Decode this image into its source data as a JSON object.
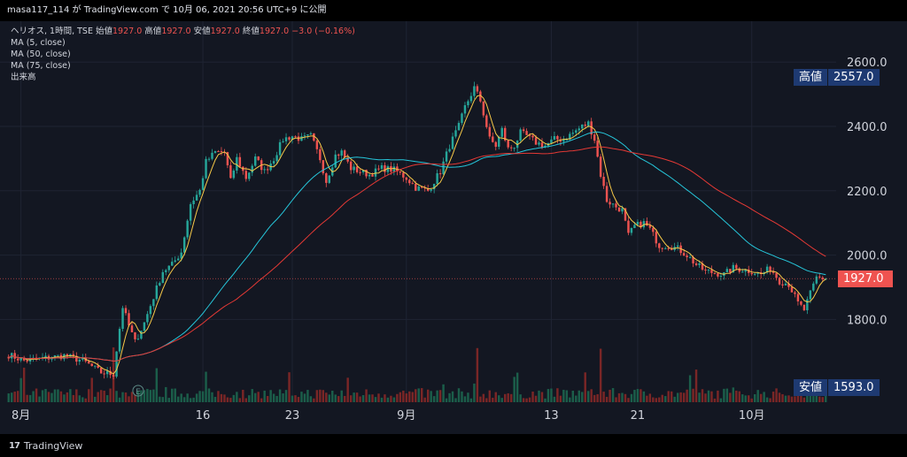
{
  "header": {
    "text": "masa117_114 が TradingView.com で 10月 06, 2021 20:56 UTC+9 に公開"
  },
  "legend": {
    "symbol": "ヘリオス, 1時間, TSE",
    "open_label": "始値",
    "open": "1927.0",
    "high_label": "高値",
    "high": "1927.0",
    "low_label": "安値",
    "low": "1927.0",
    "close_label": "終値",
    "close": "1927.0",
    "change": "−3.0 (−0.16%)",
    "ma1": "MA (5, close)",
    "ma2": "MA (50, close)",
    "ma3": "MA (75, close)",
    "volume": "出来高"
  },
  "markers": {
    "high_label": "高値",
    "high_value": "2557.0",
    "low_label": "安値",
    "low_value": "1593.0",
    "last_price": "1927.0"
  },
  "earnings_marker": "E",
  "footer": {
    "brand": "TradingView"
  },
  "colors": {
    "background": "#131722",
    "up": "#26a69a",
    "down": "#ef5350",
    "ma5": "#f7c948",
    "ma50": "#26c6da",
    "ma75": "#e53935",
    "marker_bg": "#1e3a72"
  },
  "chart_data": {
    "type": "candlestick",
    "title": "ヘリオス, 1時間, TSE",
    "ylim": [
      1600,
      2700
    ],
    "yticks": [
      1800,
      2000,
      2200,
      2400,
      2600
    ],
    "ytick_labels": [
      "1800.0",
      "2000.0",
      "2200.0",
      "2400.0",
      "2600.0"
    ],
    "xticks": [
      {
        "label": "8月",
        "bar": 4
      },
      {
        "label": "16",
        "bar": 63
      },
      {
        "label": "23",
        "bar": 92
      },
      {
        "label": "9月",
        "bar": 129
      },
      {
        "label": "13",
        "bar": 176
      },
      {
        "label": "21",
        "bar": 204
      },
      {
        "label": "10月",
        "bar": 241
      }
    ],
    "bar_count": 266,
    "price_path": [
      [
        0,
        1690
      ],
      [
        5,
        1672
      ],
      [
        12,
        1680
      ],
      [
        18,
        1688
      ],
      [
        24,
        1672
      ],
      [
        30,
        1635
      ],
      [
        34,
        1630
      ],
      [
        35,
        1705
      ],
      [
        37,
        1840
      ],
      [
        39,
        1780
      ],
      [
        41,
        1730
      ],
      [
        44,
        1790
      ],
      [
        47,
        1870
      ],
      [
        50,
        1950
      ],
      [
        53,
        1970
      ],
      [
        56,
        2010
      ],
      [
        59,
        2160
      ],
      [
        62,
        2200
      ],
      [
        64,
        2290
      ],
      [
        67,
        2320
      ],
      [
        70,
        2320
      ],
      [
        72,
        2230
      ],
      [
        74,
        2300
      ],
      [
        77,
        2240
      ],
      [
        80,
        2300
      ],
      [
        83,
        2260
      ],
      [
        86,
        2300
      ],
      [
        89,
        2360
      ],
      [
        92,
        2370
      ],
      [
        95,
        2360
      ],
      [
        98,
        2370
      ],
      [
        101,
        2300
      ],
      [
        103,
        2230
      ],
      [
        106,
        2310
      ],
      [
        108,
        2320
      ],
      [
        111,
        2270
      ],
      [
        114,
        2260
      ],
      [
        117,
        2250
      ],
      [
        121,
        2270
      ],
      [
        125,
        2265
      ],
      [
        129,
        2240
      ],
      [
        132,
        2210
      ],
      [
        136,
        2200
      ],
      [
        140,
        2260
      ],
      [
        143,
        2340
      ],
      [
        146,
        2400
      ],
      [
        148,
        2460
      ],
      [
        151,
        2520
      ],
      [
        153,
        2480
      ],
      [
        156,
        2360
      ],
      [
        158,
        2340
      ],
      [
        160,
        2390
      ],
      [
        162,
        2330
      ],
      [
        164,
        2340
      ],
      [
        166,
        2380
      ],
      [
        168,
        2370
      ],
      [
        171,
        2350
      ],
      [
        174,
        2340
      ],
      [
        177,
        2360
      ],
      [
        180,
        2360
      ],
      [
        183,
        2380
      ],
      [
        186,
        2400
      ],
      [
        188,
        2410
      ],
      [
        190,
        2360
      ],
      [
        192,
        2250
      ],
      [
        194,
        2170
      ],
      [
        197,
        2150
      ],
      [
        199,
        2140
      ],
      [
        201,
        2060
      ],
      [
        203,
        2090
      ],
      [
        206,
        2100
      ],
      [
        208,
        2080
      ],
      [
        211,
        2030
      ],
      [
        214,
        2030
      ],
      [
        217,
        2020
      ],
      [
        220,
        2000
      ],
      [
        223,
        1970
      ],
      [
        226,
        1950
      ],
      [
        229,
        1945
      ],
      [
        232,
        1940
      ],
      [
        235,
        1960
      ],
      [
        238,
        1955
      ],
      [
        241,
        1950
      ],
      [
        244,
        1940
      ],
      [
        247,
        1960
      ],
      [
        250,
        1920
      ],
      [
        253,
        1910
      ],
      [
        256,
        1850
      ],
      [
        258,
        1830
      ],
      [
        260,
        1880
      ],
      [
        262,
        1930
      ],
      [
        265,
        1927
      ]
    ],
    "series": [
      {
        "name": "MA (5, close)",
        "color": "#f7c948"
      },
      {
        "name": "MA (50, close)",
        "color": "#26c6da"
      },
      {
        "name": "MA (75, close)",
        "color": "#e53935"
      }
    ],
    "grid": true
  }
}
